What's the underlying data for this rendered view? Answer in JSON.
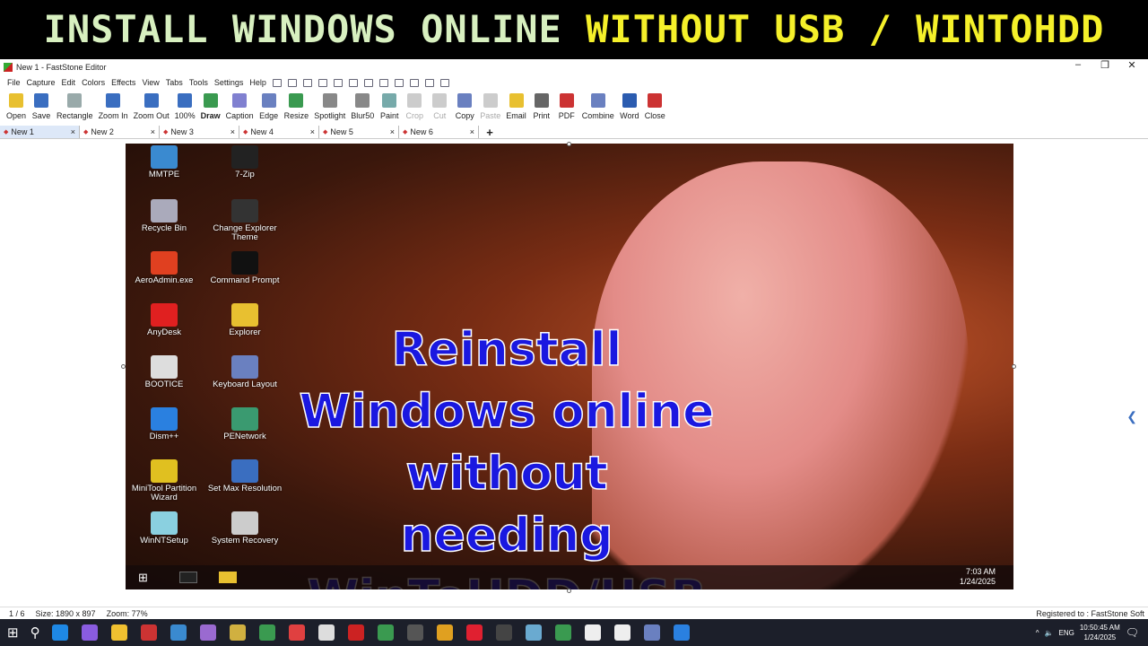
{
  "banner": {
    "part1": "INSTALL WINDOWS ONLINE",
    "part2": "WITHOUT USB / WINTOHDD"
  },
  "window": {
    "title": "New 1 - FastStone Editor"
  },
  "menu": [
    "File",
    "Capture",
    "Edit",
    "Colors",
    "Effects",
    "View",
    "Tabs",
    "Tools",
    "Settings",
    "Help"
  ],
  "toolbar": [
    {
      "label": "Open",
      "color": "#e8c030"
    },
    {
      "label": "Save",
      "color": "#3a6ec0"
    },
    {
      "label": "Rectangle",
      "color": "#9aa"
    },
    {
      "label": "Zoom In",
      "color": "#3a6ec0"
    },
    {
      "label": "Zoom Out",
      "color": "#3a6ec0"
    },
    {
      "label": "100%",
      "color": "#3a6ec0"
    },
    {
      "label": "Draw",
      "color": "#3a9a50"
    },
    {
      "label": "Caption",
      "color": "#8080d0"
    },
    {
      "label": "Edge",
      "color": "#6a80c0"
    },
    {
      "label": "Resize",
      "color": "#3a9a50"
    },
    {
      "label": "Spotlight",
      "color": "#888"
    },
    {
      "label": "Blur50",
      "color": "#888"
    },
    {
      "label": "Paint",
      "color": "#7aa"
    },
    {
      "label": "Crop",
      "color": "#ccc",
      "disabled": true
    },
    {
      "label": "Cut",
      "color": "#ccc",
      "disabled": true
    },
    {
      "label": "Copy",
      "color": "#6a80c0"
    },
    {
      "label": "Paste",
      "color": "#ccc",
      "disabled": true
    },
    {
      "label": "Email",
      "color": "#e8c030"
    },
    {
      "label": "Print",
      "color": "#666"
    },
    {
      "label": "PDF",
      "color": "#c33"
    },
    {
      "label": "Combine",
      "color": "#6a80c0"
    },
    {
      "label": "Word",
      "color": "#2b5cb0"
    },
    {
      "label": "Close",
      "color": "#c33"
    }
  ],
  "tabs": [
    "New 1",
    "New 2",
    "New 3",
    "New 4",
    "New 5",
    "New 6"
  ],
  "desktop_icons": [
    {
      "label": "MMTPE",
      "color": "#3a8ad0"
    },
    {
      "label": "7-Zip",
      "color": "#222"
    },
    {
      "label": "Recycle Bin",
      "color": "#aab"
    },
    {
      "label": "Change Explorer Theme",
      "color": "#333"
    },
    {
      "label": "AeroAdmin.exe",
      "color": "#e04020"
    },
    {
      "label": "Command Prompt",
      "color": "#111"
    },
    {
      "label": "AnyDesk",
      "color": "#e02020"
    },
    {
      "label": "Explorer",
      "color": "#e8c030"
    },
    {
      "label": "BOOTICE",
      "color": "#ddd"
    },
    {
      "label": "Keyboard Layout",
      "color": "#6a80c0"
    },
    {
      "label": "Dism++",
      "color": "#2a80e0"
    },
    {
      "label": "PENetwork",
      "color": "#3a9a70"
    },
    {
      "label": "MiniTool Partition Wizard",
      "color": "#e0c020"
    },
    {
      "label": "Set Max Resolution",
      "color": "#3a6ec0"
    },
    {
      "label": "WinNTSetup",
      "color": "#8ad0e0"
    },
    {
      "label": "System Recovery",
      "color": "#ccc"
    }
  ],
  "overlay": [
    "Reinstall",
    "Windows online",
    "without needing",
    "WinToHDD/USB"
  ],
  "inner_clock": {
    "time": "7:03 AM",
    "date": "1/24/2025"
  },
  "status": {
    "page": "1 / 6",
    "size": "Size: 1890 x 897",
    "zoom": "Zoom: 77%",
    "registered": "Registered to : FastStone Soft"
  },
  "taskbar": {
    "icons": [
      "#1e88e5",
      "#8a5ce0",
      "#f0c030",
      "#c33",
      "#3a8ad0",
      "#9a6ad0",
      "#d0b040",
      "#3a9a50",
      "#e04040",
      "#ddd",
      "#c22",
      "#3a9a50",
      "#555",
      "#e0a020",
      "#e02030",
      "#444",
      "#6aaad0",
      "#3a9a50",
      "#eee",
      "#eee",
      "#6a80c0",
      "#2a80e0"
    ],
    "lang": "ENG",
    "time": "10:50:45 AM",
    "date": "1/24/2025"
  }
}
